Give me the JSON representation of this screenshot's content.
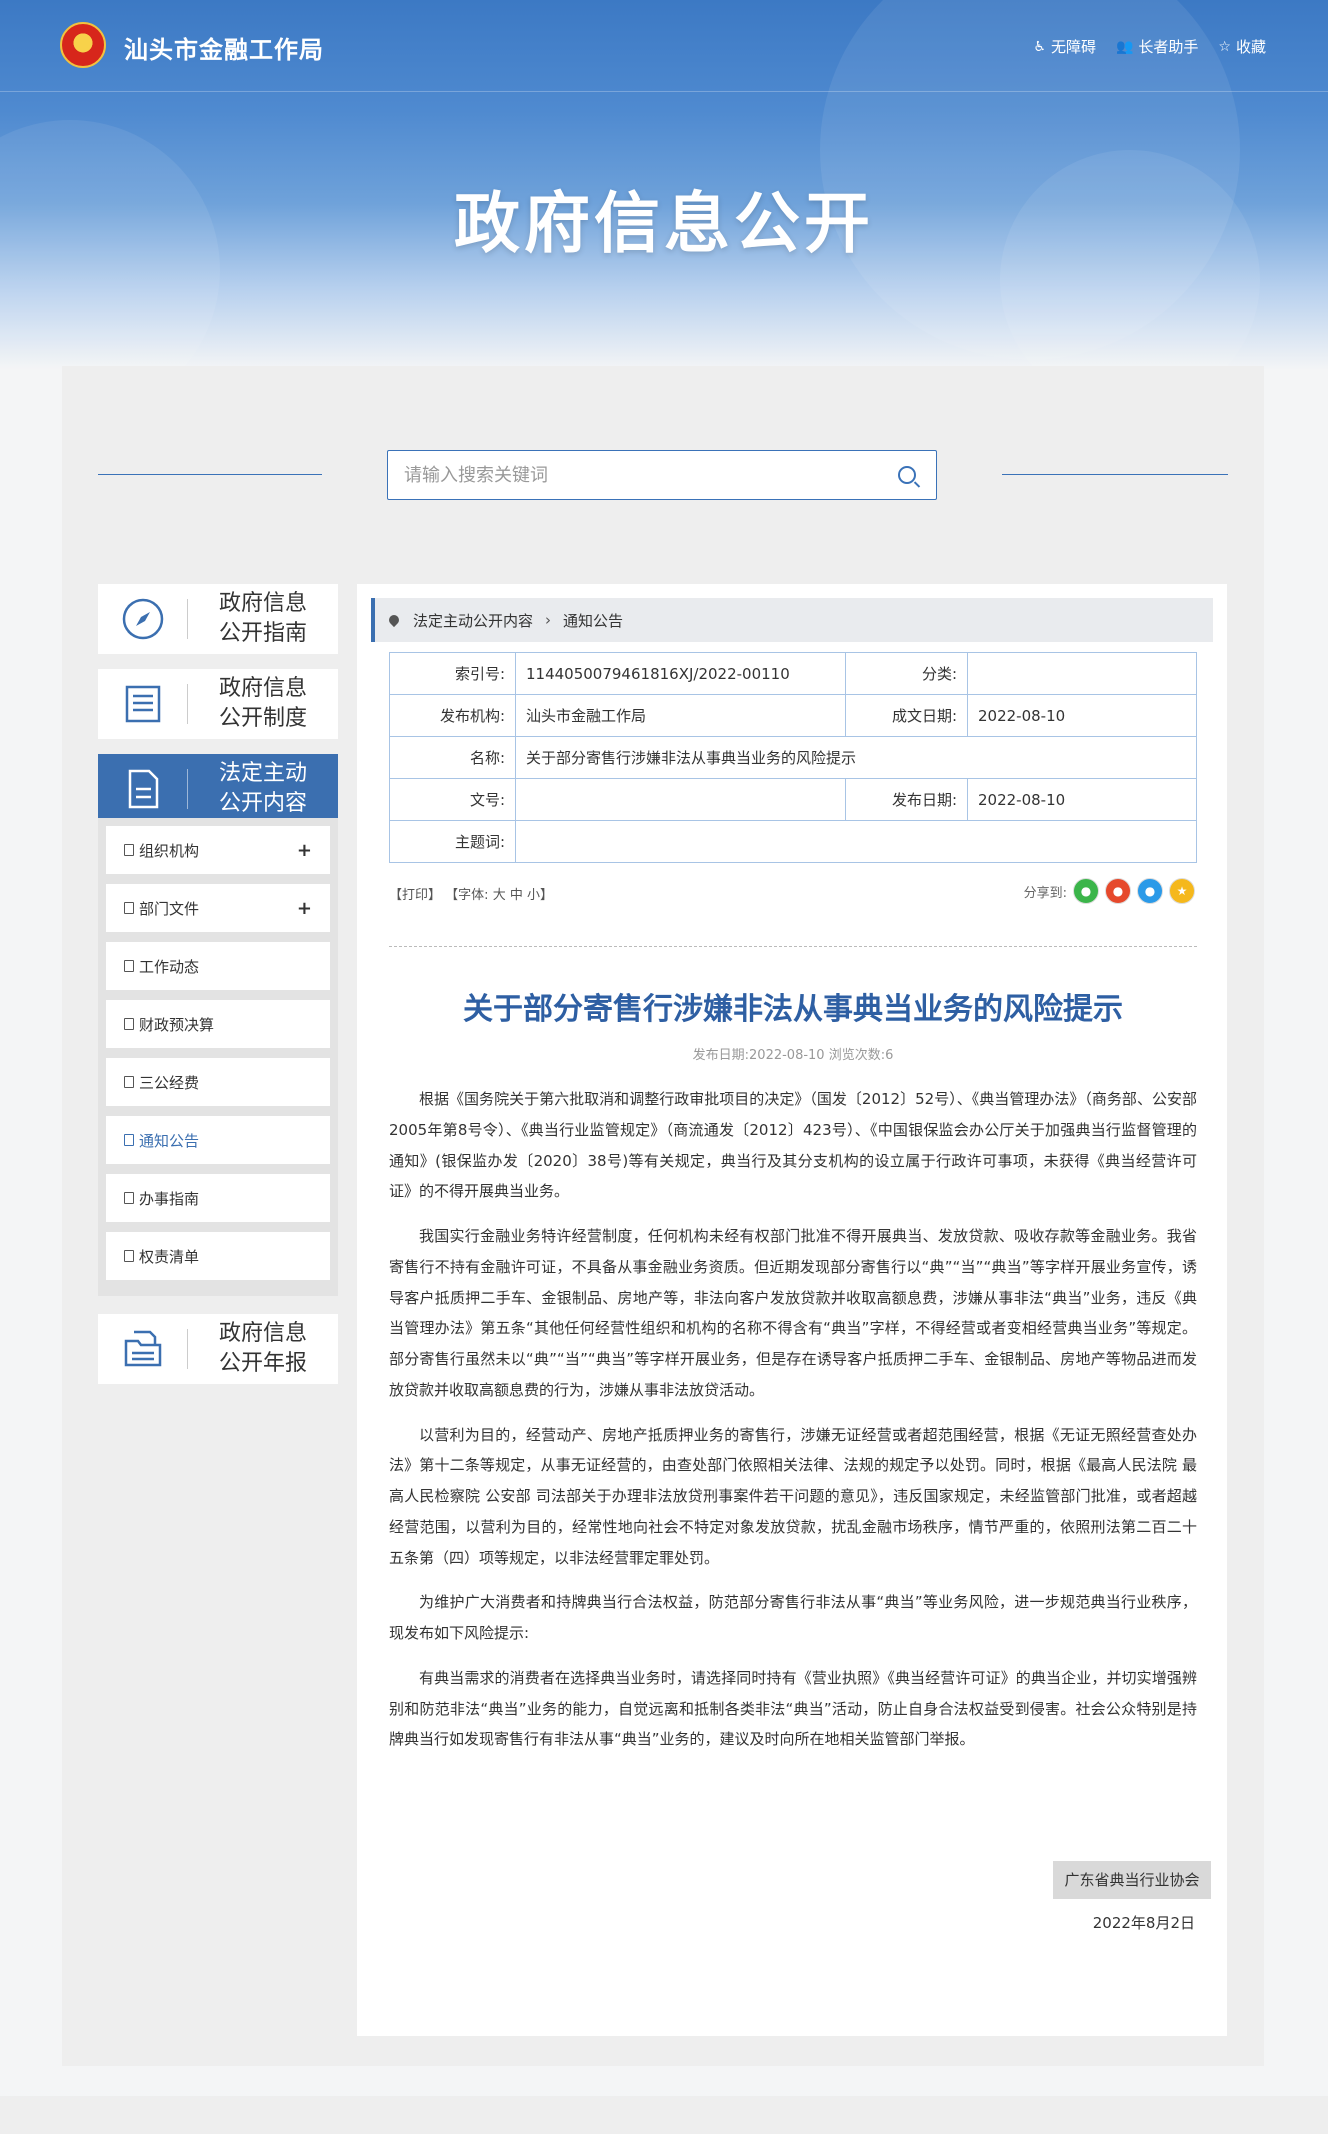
{
  "header": {
    "site_name": "汕头市金融工作局",
    "tools": [
      {
        "icon": "accessibility-icon",
        "label": "无障碍"
      },
      {
        "icon": "elder-icon",
        "label": "长者助手"
      },
      {
        "icon": "star-icon",
        "label": "收藏"
      }
    ],
    "banner_title": "政府信息公开"
  },
  "search": {
    "placeholder": "请输入搜索关键词"
  },
  "sidebar": {
    "blocks": [
      {
        "label_line1": "政府信息",
        "label_line2": "公开指南"
      },
      {
        "label_line1": "政府信息",
        "label_line2": "公开制度"
      },
      {
        "label_line1": "法定主动",
        "label_line2": "公开内容"
      },
      {
        "label_line1": "政府信息",
        "label_line2": "公开年报"
      }
    ],
    "submenu": [
      {
        "label": "组织机构",
        "expand": "+"
      },
      {
        "label": "部门文件",
        "expand": "+"
      },
      {
        "label": "工作动态"
      },
      {
        "label": "财政预决算"
      },
      {
        "label": "三公经费"
      },
      {
        "label": "通知公告"
      },
      {
        "label": "办事指南"
      },
      {
        "label": "权责清单"
      }
    ]
  },
  "breadcrumb": {
    "item1": "法定主动公开内容",
    "sep": "›",
    "item2": "通知公告"
  },
  "meta": {
    "index_label": "索引号:",
    "index_value": "1144050079461816XJ/2022-00110",
    "category_label": "分类:",
    "category_value": "",
    "org_label": "发布机构:",
    "org_value": "汕头市金融工作局",
    "created_label": "成文日期:",
    "created_value": "2022-08-10",
    "name_label": "名称:",
    "name_value": "关于部分寄售行涉嫌非法从事典当业务的风险提示",
    "docno_label": "文号:",
    "docno_value": "",
    "published_label": "发布日期:",
    "published_value": "2022-08-10",
    "keywords_label": "主题词:",
    "keywords_value": ""
  },
  "article_tools": {
    "print": "【打印】",
    "font_label": "【字体:",
    "font_large": "大",
    "font_medium": "中",
    "font_small": "小】",
    "share_label": "分享到:"
  },
  "article": {
    "title": "关于部分寄售行涉嫌非法从事典当业务的风险提示",
    "pubinfo": "发布日期:2022-08-10  浏览次数:6",
    "paragraphs": [
      "根据《国务院关于第六批取消和调整行政审批项目的决定》（国发〔2012〕52号）、《典当管理办法》（商务部、公安部2005年第8号令）、《典当行业监管规定》（商流通发〔2012〕423号）、《中国银保监会办公厅关于加强典当行监督管理的通知》(银保监办发〔2020〕38号)等有关规定，典当行及其分支机构的设立属于行政许可事项，未获得《典当经营许可证》的不得开展典当业务。",
      "我国实行金融业务特许经营制度，任何机构未经有权部门批准不得开展典当、发放贷款、吸收存款等金融业务。我省寄售行不持有金融许可证，不具备从事金融业务资质。但近期发现部分寄售行以“典”“当”“典当”等字样开展业务宣传，诱导客户抵质押二手车、金银制品、房地产等，非法向客户发放贷款并收取高额息费，涉嫌从事非法“典当”业务，违反《典当管理办法》第五条“其他任何经营性组织和机构的名称不得含有“典当”字样，不得经营或者变相经营典当业务”等规定。部分寄售行虽然未以“典”“当”“典当”等字样开展业务，但是存在诱导客户抵质押二手车、金银制品、房地产等物品进而发放贷款并收取高额息费的行为，涉嫌从事非法放贷活动。",
      "以营利为目的，经营动产、房地产抵质押业务的寄售行，涉嫌无证经营或者超范围经营，根据《无证无照经营查处办法》第十二条等规定，从事无证经营的，由查处部门依照相关法律、法规的规定予以处罚。同时，根据《最高人民法院 最高人民检察院 公安部 司法部关于办理非法放贷刑事案件若干问题的意见》，违反国家规定，未经监管部门批准，或者超越经营范围，以营利为目的，经常性地向社会不特定对象发放贷款，扰乱金融市场秩序，情节严重的，依照刑法第二百二十五条第（四）项等规定，以非法经营罪定罪处罚。",
      "为维护广大消费者和持牌典当行合法权益，防范部分寄售行非法从事“典当”等业务风险，进一步规范典当行业秩序，现发布如下风险提示:",
      "有典当需求的消费者在选择典当业务时，请选择同时持有《营业执照》《典当经营许可证》的典当企业，并切实增强辨别和防范非法“典当”业务的能力，自觉远离和抵制各类非法“典当”活动，防止自身合法权益受到侵害。社会公众特别是持牌典当行如发现寄售行有非法从事“典当”业务的，建议及时向所在地相关监管部门举报。"
    ],
    "signer": "广东省典当行业协会",
    "sign_date": "2022年8月2日"
  },
  "colors": {
    "brand": "#3b6fb0",
    "title": "#2e5fa3"
  }
}
